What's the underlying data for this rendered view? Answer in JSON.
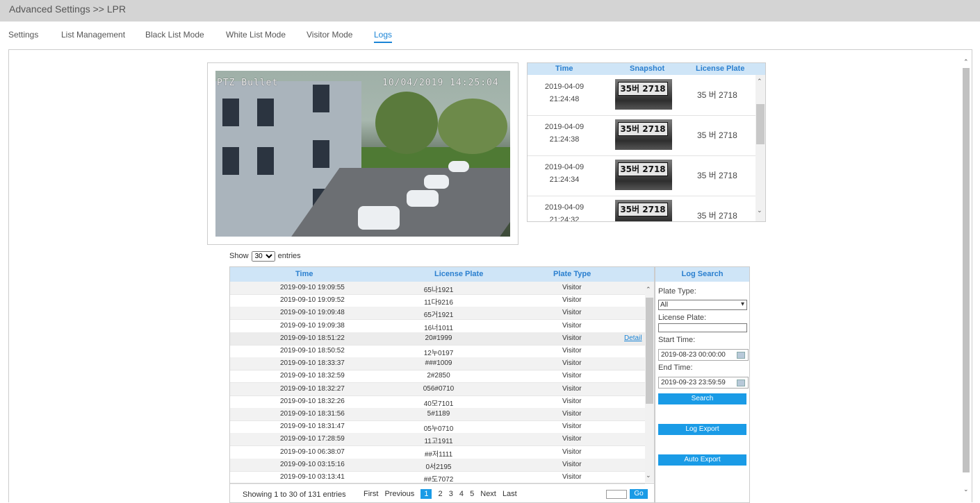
{
  "header": {
    "title": "Advanced Settings >> LPR"
  },
  "tabs": [
    {
      "label": "Settings"
    },
    {
      "label": "List Management"
    },
    {
      "label": "Black List Mode"
    },
    {
      "label": "White List Mode"
    },
    {
      "label": "Visitor Mode"
    },
    {
      "label": "Logs",
      "active": true
    }
  ],
  "video": {
    "camera_name": "PTZ Bullet",
    "timestamp": "10/04/2019 14:25:04"
  },
  "snapshots": {
    "columns": [
      "Time",
      "Snapshot",
      "License Plate"
    ],
    "rows": [
      {
        "date": "2019-04-09",
        "time": "21:24:48",
        "plate_image_text": "35버 2718",
        "plate": "35 버 2718"
      },
      {
        "date": "2019-04-09",
        "time": "21:24:38",
        "plate_image_text": "35버 2718",
        "plate": "35 버 2718"
      },
      {
        "date": "2019-04-09",
        "time": "21:24:34",
        "plate_image_text": "35버 2718",
        "plate": "35 버 2718"
      },
      {
        "date": "2019-04-09",
        "time": "21:24:32",
        "plate_image_text": "35버 2718",
        "plate": "35 버 2718"
      }
    ]
  },
  "show_entries": {
    "prefix": "Show",
    "value": "30",
    "suffix": "entries"
  },
  "log_table": {
    "columns": [
      "Time",
      "License Plate",
      "Plate Type"
    ],
    "detail_label": "Detail",
    "rows": [
      {
        "time": "2019-09-10 19:09:55",
        "plate": "65나1921",
        "type": "Visitor"
      },
      {
        "time": "2019-09-10 19:09:52",
        "plate": "11다9216",
        "type": "Visitor"
      },
      {
        "time": "2019-09-10 19:09:48",
        "plate": "65거1921",
        "type": "Visitor"
      },
      {
        "time": "2019-09-10 19:09:38",
        "plate": "16너1011",
        "type": "Visitor"
      },
      {
        "time": "2019-09-10 18:51:22",
        "plate": "20#1999",
        "type": "Visitor"
      },
      {
        "time": "2019-09-10 18:50:52",
        "plate": "12누0197",
        "type": "Visitor"
      },
      {
        "time": "2019-09-10 18:33:37",
        "plate": "###1009",
        "type": "Visitor"
      },
      {
        "time": "2019-09-10 18:32:59",
        "plate": "2#2850",
        "type": "Visitor"
      },
      {
        "time": "2019-09-10 18:32:27",
        "plate": "056#0710",
        "type": "Visitor"
      },
      {
        "time": "2019-09-10 18:32:26",
        "plate": "40모7101",
        "type": "Visitor"
      },
      {
        "time": "2019-09-10 18:31:56",
        "plate": "5#1189",
        "type": "Visitor"
      },
      {
        "time": "2019-09-10 18:31:47",
        "plate": "05누0710",
        "type": "Visitor"
      },
      {
        "time": "2019-09-10 17:28:59",
        "plate": "11고1911",
        "type": "Visitor"
      },
      {
        "time": "2019-09-10 06:38:07",
        "plate": "##저1111",
        "type": "Visitor"
      },
      {
        "time": "2019-09-10 03:15:16",
        "plate": "0서2195",
        "type": "Visitor"
      },
      {
        "time": "2019-09-10 03:13:41",
        "plate": "##도7072",
        "type": "Visitor"
      }
    ],
    "footer": {
      "info": "Showing 1 to 30 of 131 entries",
      "first": "First",
      "previous": "Previous",
      "pages": [
        "1",
        "2",
        "3",
        "4",
        "5"
      ],
      "next": "Next",
      "last": "Last",
      "go": "Go"
    }
  },
  "log_search": {
    "title": "Log Search",
    "plate_type_label": "Plate Type:",
    "plate_type_value": "All",
    "license_plate_label": "License Plate:",
    "start_time_label": "Start Time:",
    "start_time_value": "2019-08-23 00:00:00",
    "end_time_label": "End Time:",
    "end_time_value": "2019-09-23 23:59:59",
    "search_button": "Search",
    "log_export_button": "Log Export",
    "auto_export_button": "Auto Export"
  },
  "colors": {
    "accent": "#1a9be6",
    "header_bg": "#cfe5f7",
    "header_text": "#2a7fcf",
    "topbar": "#d4d4d4"
  }
}
